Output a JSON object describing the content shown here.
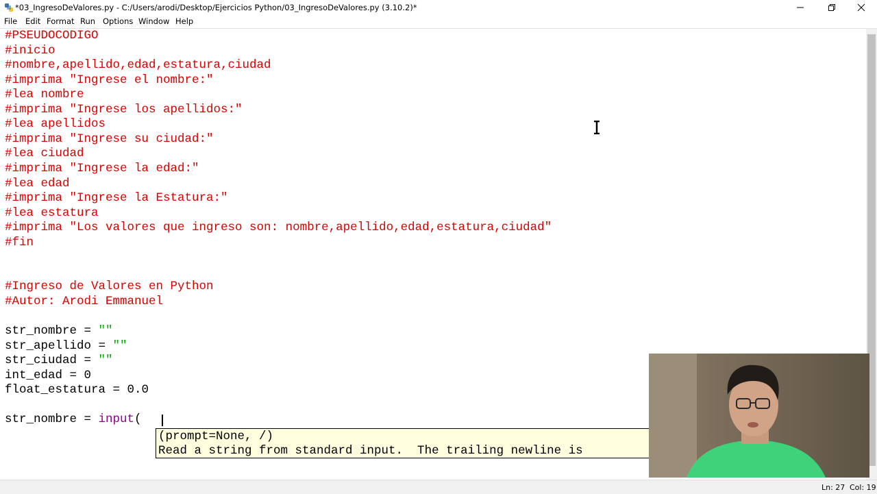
{
  "window": {
    "title": "*03_IngresoDeValores.py - C:/Users/arodi/Desktop/Ejercicios Python/03_IngresoDeValores.py (3.10.2)*",
    "app_icon": "python-icon",
    "controls": [
      "minimize-icon",
      "restore-icon",
      "close-icon"
    ]
  },
  "menu": [
    "File",
    "Edit",
    "Format",
    "Run",
    "Options",
    "Window",
    "Help"
  ],
  "code_lines": [
    [
      {
        "t": "#PSEUDOCODIGO",
        "c": "comment"
      }
    ],
    [
      {
        "t": "#inicio",
        "c": "comment"
      }
    ],
    [
      {
        "t": "#nombre,apellido,edad,estatura,ciudad",
        "c": "comment"
      }
    ],
    [
      {
        "t": "#imprima \"Ingrese el nombre:\"",
        "c": "comment"
      }
    ],
    [
      {
        "t": "#lea nombre",
        "c": "comment"
      }
    ],
    [
      {
        "t": "#imprima \"Ingrese los apellidos:\"",
        "c": "comment"
      }
    ],
    [
      {
        "t": "#lea apellidos",
        "c": "comment"
      }
    ],
    [
      {
        "t": "#imprima \"Ingrese su ciudad:\"",
        "c": "comment"
      }
    ],
    [
      {
        "t": "#lea ciudad",
        "c": "comment"
      }
    ],
    [
      {
        "t": "#imprima \"Ingrese la edad:\"",
        "c": "comment"
      }
    ],
    [
      {
        "t": "#lea edad",
        "c": "comment"
      }
    ],
    [
      {
        "t": "#imprima \"Ingrese la Estatura:\"",
        "c": "comment"
      }
    ],
    [
      {
        "t": "#lea estatura",
        "c": "comment"
      }
    ],
    [
      {
        "t": "#imprima \"Los valores que ingreso son: nombre,apellido,edad,estatura,ciudad\"",
        "c": "comment"
      }
    ],
    [
      {
        "t": "#fin",
        "c": "comment"
      }
    ],
    [],
    [],
    [
      {
        "t": "#Ingreso de Valores en Python",
        "c": "comment"
      }
    ],
    [
      {
        "t": "#Autor: Arodi Emmanuel",
        "c": "comment"
      }
    ],
    [],
    [
      {
        "t": "str_nombre = ",
        "c": "normal"
      },
      {
        "t": "\"\"",
        "c": "str"
      }
    ],
    [
      {
        "t": "str_apellido = ",
        "c": "normal"
      },
      {
        "t": "\"\"",
        "c": "str"
      }
    ],
    [
      {
        "t": "str_ciudad = ",
        "c": "normal"
      },
      {
        "t": "\"\"",
        "c": "str"
      }
    ],
    [
      {
        "t": "int_edad = 0",
        "c": "normal"
      }
    ],
    [
      {
        "t": "float_estatura = 0.0",
        "c": "normal"
      }
    ],
    [],
    [
      {
        "t": "str_nombre = ",
        "c": "normal"
      },
      {
        "t": "input",
        "c": "builtin"
      },
      {
        "t": "(",
        "c": "normal"
      }
    ]
  ],
  "calltip": {
    "signature": "(prompt=None, /)",
    "doc": "Read a string from standard input.  The trailing newline is"
  },
  "status": {
    "line": "Ln: 27",
    "col": "Col: 19"
  },
  "colors": {
    "comment": "#dd0000",
    "string": "#00aa00",
    "builtin": "#900090",
    "calltip_bg": "#ffffe0"
  }
}
